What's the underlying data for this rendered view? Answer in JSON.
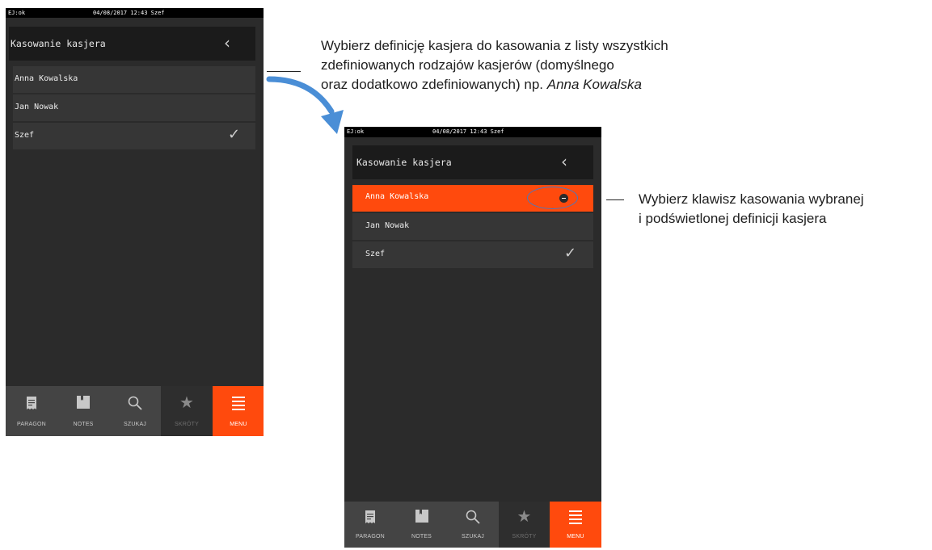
{
  "status": {
    "left": "EJ:ok",
    "center": "04/08/2017  12:43  Szef"
  },
  "screen": {
    "title": "Kasowanie kasjera",
    "back_icon": "chevron-left",
    "items": [
      "Anna Kowalska",
      "Jan Nowak",
      "Szef"
    ],
    "checked_item": "Szef",
    "selected_item": "Anna Kowalska"
  },
  "tabs": [
    {
      "label": "PARAGON",
      "icon": "receipt-icon"
    },
    {
      "label": "NOTES",
      "icon": "notebook-icon"
    },
    {
      "label": "SZUKAJ",
      "icon": "search-icon"
    },
    {
      "label": "SKRÓTY",
      "icon": "star-icon"
    },
    {
      "label": "MENU",
      "icon": "menu-icon"
    }
  ],
  "annotations": {
    "first": [
      "Wybierz definicję kasjera do kasowania z listy wszystkich",
      "zdefiniowanych rodzajów kasjerów (domyślnego",
      "oraz dodatkowo zdefiniowanych) np. "
    ],
    "first_italic": "Anna Kowalska",
    "second": [
      "Wybierz klawisz kasowania wybranej",
      "i podświetlonej definicji kasjera"
    ]
  },
  "colors": {
    "accent": "#ff4a0d",
    "arrow": "#4a8ed6",
    "background": "#2b2b2b"
  }
}
